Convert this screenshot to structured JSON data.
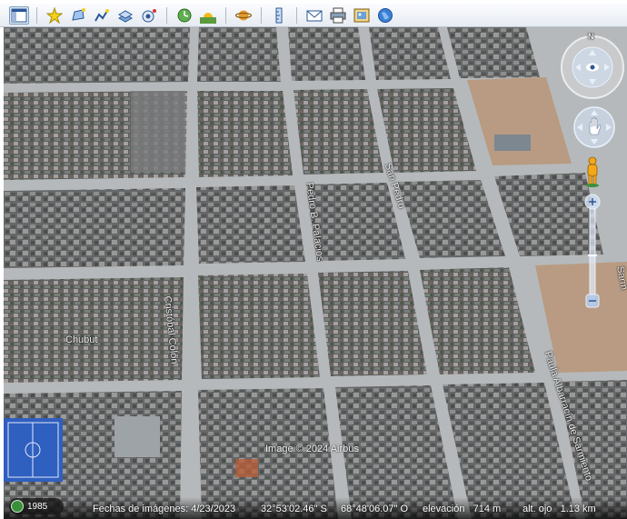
{
  "toolbar": {
    "buttons": [
      {
        "name": "sidebar-toggle-button",
        "icon": "sidebar-icon",
        "active": true
      },
      {
        "name": "add-placemark-button",
        "icon": "pushpin-star-icon"
      },
      {
        "name": "add-polygon-button",
        "icon": "polygon-icon"
      },
      {
        "name": "add-path-button",
        "icon": "path-icon"
      },
      {
        "name": "add-image-overlay-button",
        "icon": "image-overlay-icon"
      },
      {
        "name": "record-tour-button",
        "icon": "record-tour-icon"
      },
      {
        "name": "historical-imagery-button",
        "icon": "clock-icon"
      },
      {
        "name": "sunlight-button",
        "icon": "sunrise-icon"
      },
      {
        "name": "switch-planet-button",
        "icon": "planet-icon"
      },
      {
        "name": "ruler-button",
        "icon": "ruler-icon"
      },
      {
        "name": "email-button",
        "icon": "envelope-icon"
      },
      {
        "name": "print-button",
        "icon": "printer-icon"
      },
      {
        "name": "save-image-button",
        "icon": "save-image-icon"
      },
      {
        "name": "view-in-maps-button",
        "icon": "globe-icon"
      }
    ]
  },
  "map": {
    "streets": {
      "chubut": "Chubut",
      "cristobal_colon": "Cristóbal Colón",
      "pedro_palacios": "Pedro B. Palacios",
      "san_pedro": "San Pedro",
      "paula_albarracin": "Paula Albarracín de Sarmiento",
      "sarm": "Sarm"
    },
    "copyright": "Image © 2024 Airbus",
    "compass_letter": "N"
  },
  "status": {
    "year": "1985",
    "imagery_date": "Fechas de imágenes: 4/23/2023",
    "latitude": "32°53'02.46\" S",
    "longitude": "68°48'06.07\" O",
    "elevation": "elevación   714 m",
    "eye_altitude": "alt. ojo   1.13 km"
  },
  "colors": {
    "toolbar_top": "#fbfcfe",
    "toolbar_bottom": "#e6ebf2",
    "street": "#b9bcbe",
    "block": "#6b6c6c",
    "court": "#2f5fbf",
    "dirt": "#b89b82"
  }
}
